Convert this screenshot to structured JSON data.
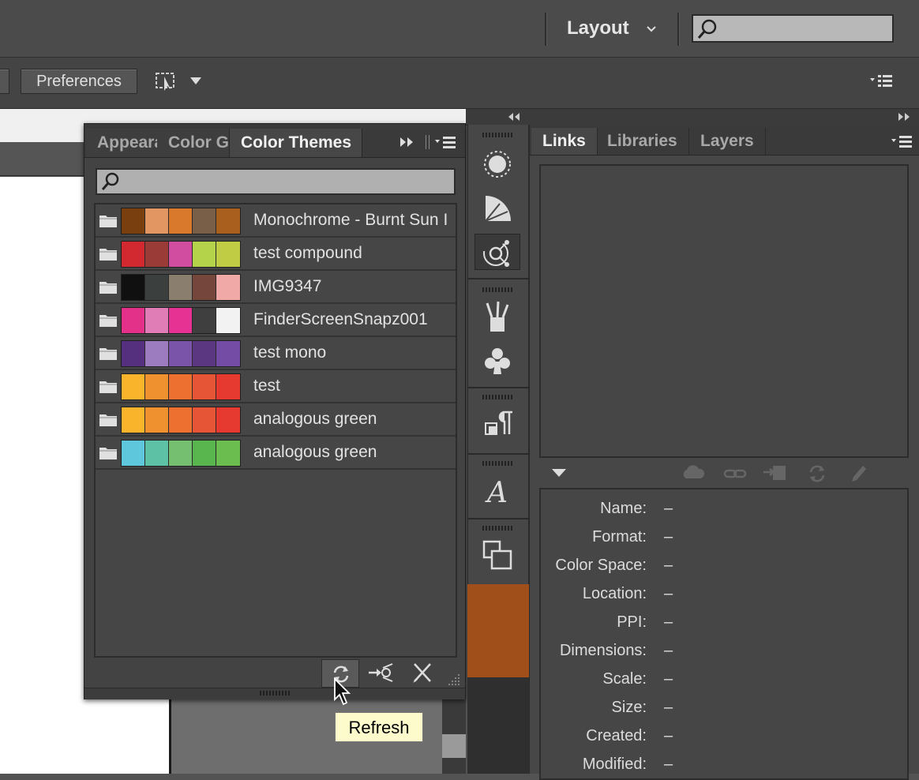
{
  "header": {
    "layout_label": "Layout",
    "search_placeholder": ""
  },
  "toolbar": {
    "preferences_label": "Preferences"
  },
  "color_themes_panel": {
    "tabs": [
      "Appearance",
      "Color Guide",
      "Color Themes"
    ],
    "active_tab": "Color Themes",
    "search_placeholder": "",
    "themes": [
      {
        "name": "Monochrome - Burnt Sun I",
        "colors": [
          "#7a3f0e",
          "#e29763",
          "#d9792b",
          "#7a5f48",
          "#a9601e"
        ]
      },
      {
        "name": "test compound",
        "colors": [
          "#d2282f",
          "#9b3b38",
          "#d04da0",
          "#b4d24a",
          "#c0cc44"
        ]
      },
      {
        "name": "IMG9347",
        "colors": [
          "#101010",
          "#3b3f3d",
          "#8a7e6e",
          "#74463c",
          "#f1a9a8"
        ]
      },
      {
        "name": "FinderScreenSnapz001",
        "colors": [
          "#e33189",
          "#e17db6",
          "#e53293",
          "#3f3f3f",
          "#f1f2f1"
        ]
      },
      {
        "name": "test mono",
        "colors": [
          "#55307f",
          "#9d7bbf",
          "#7954a8",
          "#5b3781",
          "#744ca5"
        ]
      },
      {
        "name": "test",
        "colors": [
          "#f9b42c",
          "#f09130",
          "#ed7031",
          "#e65536",
          "#e63a30"
        ]
      },
      {
        "name": "analogous green",
        "colors": [
          "#f9b42c",
          "#f09130",
          "#ed7031",
          "#e65536",
          "#e63a30"
        ]
      },
      {
        "name": "analogous green",
        "colors": [
          "#5ec7db",
          "#5dc2a5",
          "#75c070",
          "#59b54e",
          "#6cbd4f"
        ]
      }
    ],
    "tooltip": "Refresh"
  },
  "links_panel": {
    "tabs": [
      "Links",
      "Libraries",
      "Layers"
    ],
    "active_tab": "Links",
    "info": [
      {
        "label": "Name:",
        "value": "–"
      },
      {
        "label": "Format:",
        "value": "–"
      },
      {
        "label": "Color Space:",
        "value": "–"
      },
      {
        "label": "Location:",
        "value": "–"
      },
      {
        "label": "PPI:",
        "value": "–"
      },
      {
        "label": "Dimensions:",
        "value": "–"
      },
      {
        "label": "Scale:",
        "value": "–"
      },
      {
        "label": "Size:",
        "value": "–"
      },
      {
        "label": "Created:",
        "value": "–"
      },
      {
        "label": "Modified:",
        "value": "–"
      }
    ]
  },
  "icons": {
    "top_search": "search-icon",
    "toolbar_arrange": "arrange-documents-icon",
    "panel_menu": "panel-menu-icon",
    "refresh": "refresh-icon",
    "add_to_swatches": "add-to-swatches-icon",
    "edit_theme": "edit-theme-icon"
  }
}
